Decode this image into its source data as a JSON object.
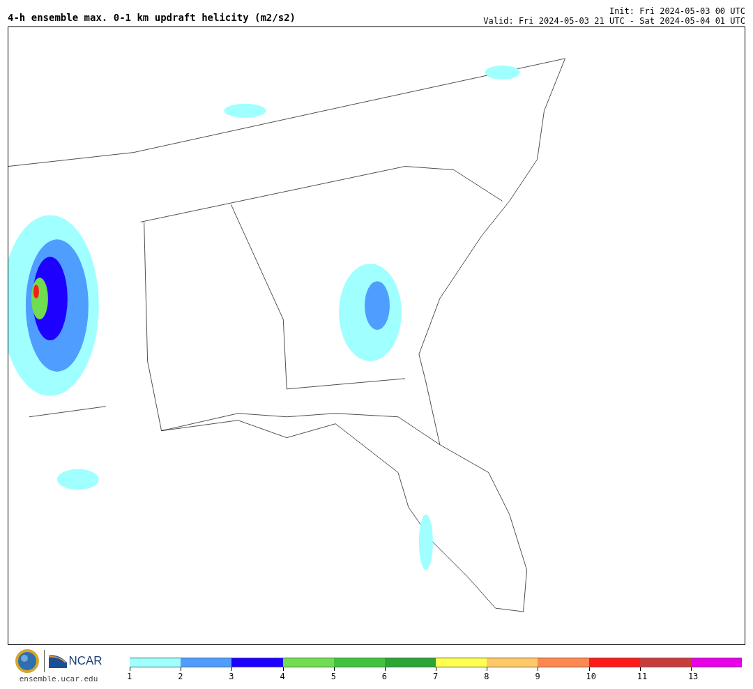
{
  "header": {
    "title": "4-h ensemble max. 0-1 km updraft helicity (m2/s2)",
    "init": "Init: Fri 2024-05-03 00 UTC",
    "valid": "Valid: Fri 2024-05-03 21 UTC - Sat 2024-05-04 01 UTC"
  },
  "footer": {
    "logo_text": "NCAR",
    "url": "ensemble.ucar.edu"
  },
  "colorbar": [
    {
      "label": "1",
      "color": "#a0ffff"
    },
    {
      "label": "2",
      "color": "#4f9dff"
    },
    {
      "label": "3",
      "color": "#1e00ff"
    },
    {
      "label": "4",
      "color": "#70dc50"
    },
    {
      "label": "5",
      "color": "#41c43d"
    },
    {
      "label": "6",
      "color": "#2ba533"
    },
    {
      "label": "7",
      "color": "#ffff50"
    },
    {
      "label": "8",
      "color": "#ffc966"
    },
    {
      "label": "9",
      "color": "#ff8750"
    },
    {
      "label": "10",
      "color": "#ff1a1a"
    },
    {
      "label": "11",
      "color": "#c83c3c"
    },
    {
      "label": "13",
      "color": "#e800e8"
    }
  ]
}
